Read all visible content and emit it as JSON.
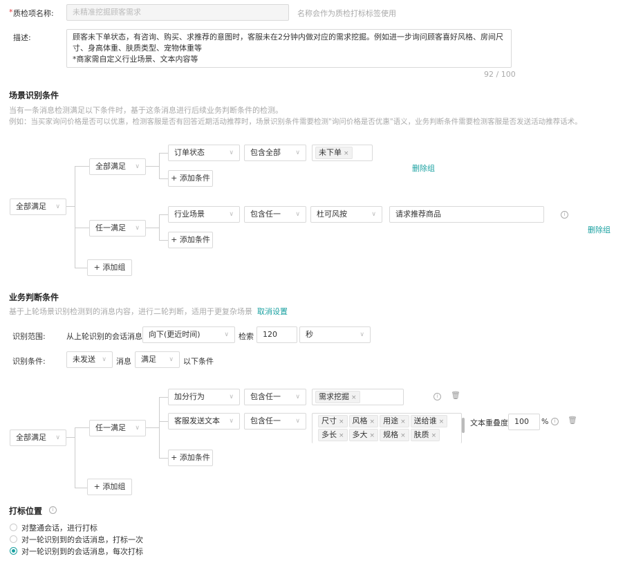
{
  "basic": {
    "name_label": "质检项名称:",
    "required_mark": "*",
    "name_value": "未精准挖掘顾客需求",
    "name_hint": "名称会作为质检打标标签使用",
    "desc_label": "描述:",
    "desc_value": "顾客未下单状态，有咨询、购买、求推荐的意图时，客服未在2分钟内做对应的需求挖掘。例如进一步询问顾客喜好风格、房间尺寸、身高体重、肤质类型、宠物体重等\n*商家需自定义行业场景、文本内容等",
    "desc_counter": "92 / 100"
  },
  "scene": {
    "title": "场景识别条件",
    "desc1": "当有一条消息检测满足以下条件时，基于这条消息进行后续业务判断条件的检测。",
    "desc2": "例如：当买家询问价格是否可以优惠，检测客服是否有回答近期活动推荐时，场景识别条件需要检测\"询问价格是否优惠\"语义，业务判断条件需要检测客服是否发送活动推荐话术。",
    "root": "全部满足",
    "group1": {
      "mode": "全部满足",
      "cond": {
        "field": "订单状态",
        "op": "包含全部",
        "tags": [
          "未下单"
        ]
      },
      "add_cond": "+ 添加条件",
      "delete": "删除组"
    },
    "group2": {
      "mode": "任一满足",
      "cond": {
        "field": "行业场景",
        "op": "包含任一",
        "industry": "杜可风按",
        "value": "请求推荐商品"
      },
      "add_cond": "+ 添加条件",
      "delete": "删除组"
    },
    "add_group": "+ 添加组"
  },
  "business": {
    "title": "业务判断条件",
    "desc": "基于上轮场景识别检测到的消息内容，进行二轮判断，适用于更复杂场景",
    "cancel": "取消设置",
    "range_label": "识别范围:",
    "range_text": "从上轮识别的会话消息",
    "direction": "向下(更近时间)",
    "search_label": "检索",
    "search_value": "120",
    "unit": "秒",
    "cond_label": "识别条件:",
    "send_state": "未发送",
    "msg_label": "消息",
    "satisfy": "满足",
    "below": "以下条件",
    "root": "全部满足",
    "group": "任一满足",
    "cond1": {
      "field": "加分行为",
      "op": "包含任一",
      "tags": [
        "需求挖掘"
      ]
    },
    "cond2": {
      "field": "客服发送文本",
      "op": "包含任一",
      "tags": [
        "尺寸",
        "风格",
        "用途",
        "送给谁",
        "多长",
        "多大",
        "规格",
        "肤质"
      ],
      "overlap_label": "文本重叠度",
      "overlap_value": "100",
      "percent": "%"
    },
    "add_cond": "+ 添加条件",
    "add_group": "+ 添加组"
  },
  "mark": {
    "title": "打标位置",
    "options": [
      "对整通会话，进行打标",
      "对一轮识别到的会话消息，打标一次",
      "对一轮识别到的会话消息，每次打标"
    ],
    "selected": 2
  },
  "colors": {
    "accent": "#1aa1a1",
    "required": "#e4393c"
  }
}
